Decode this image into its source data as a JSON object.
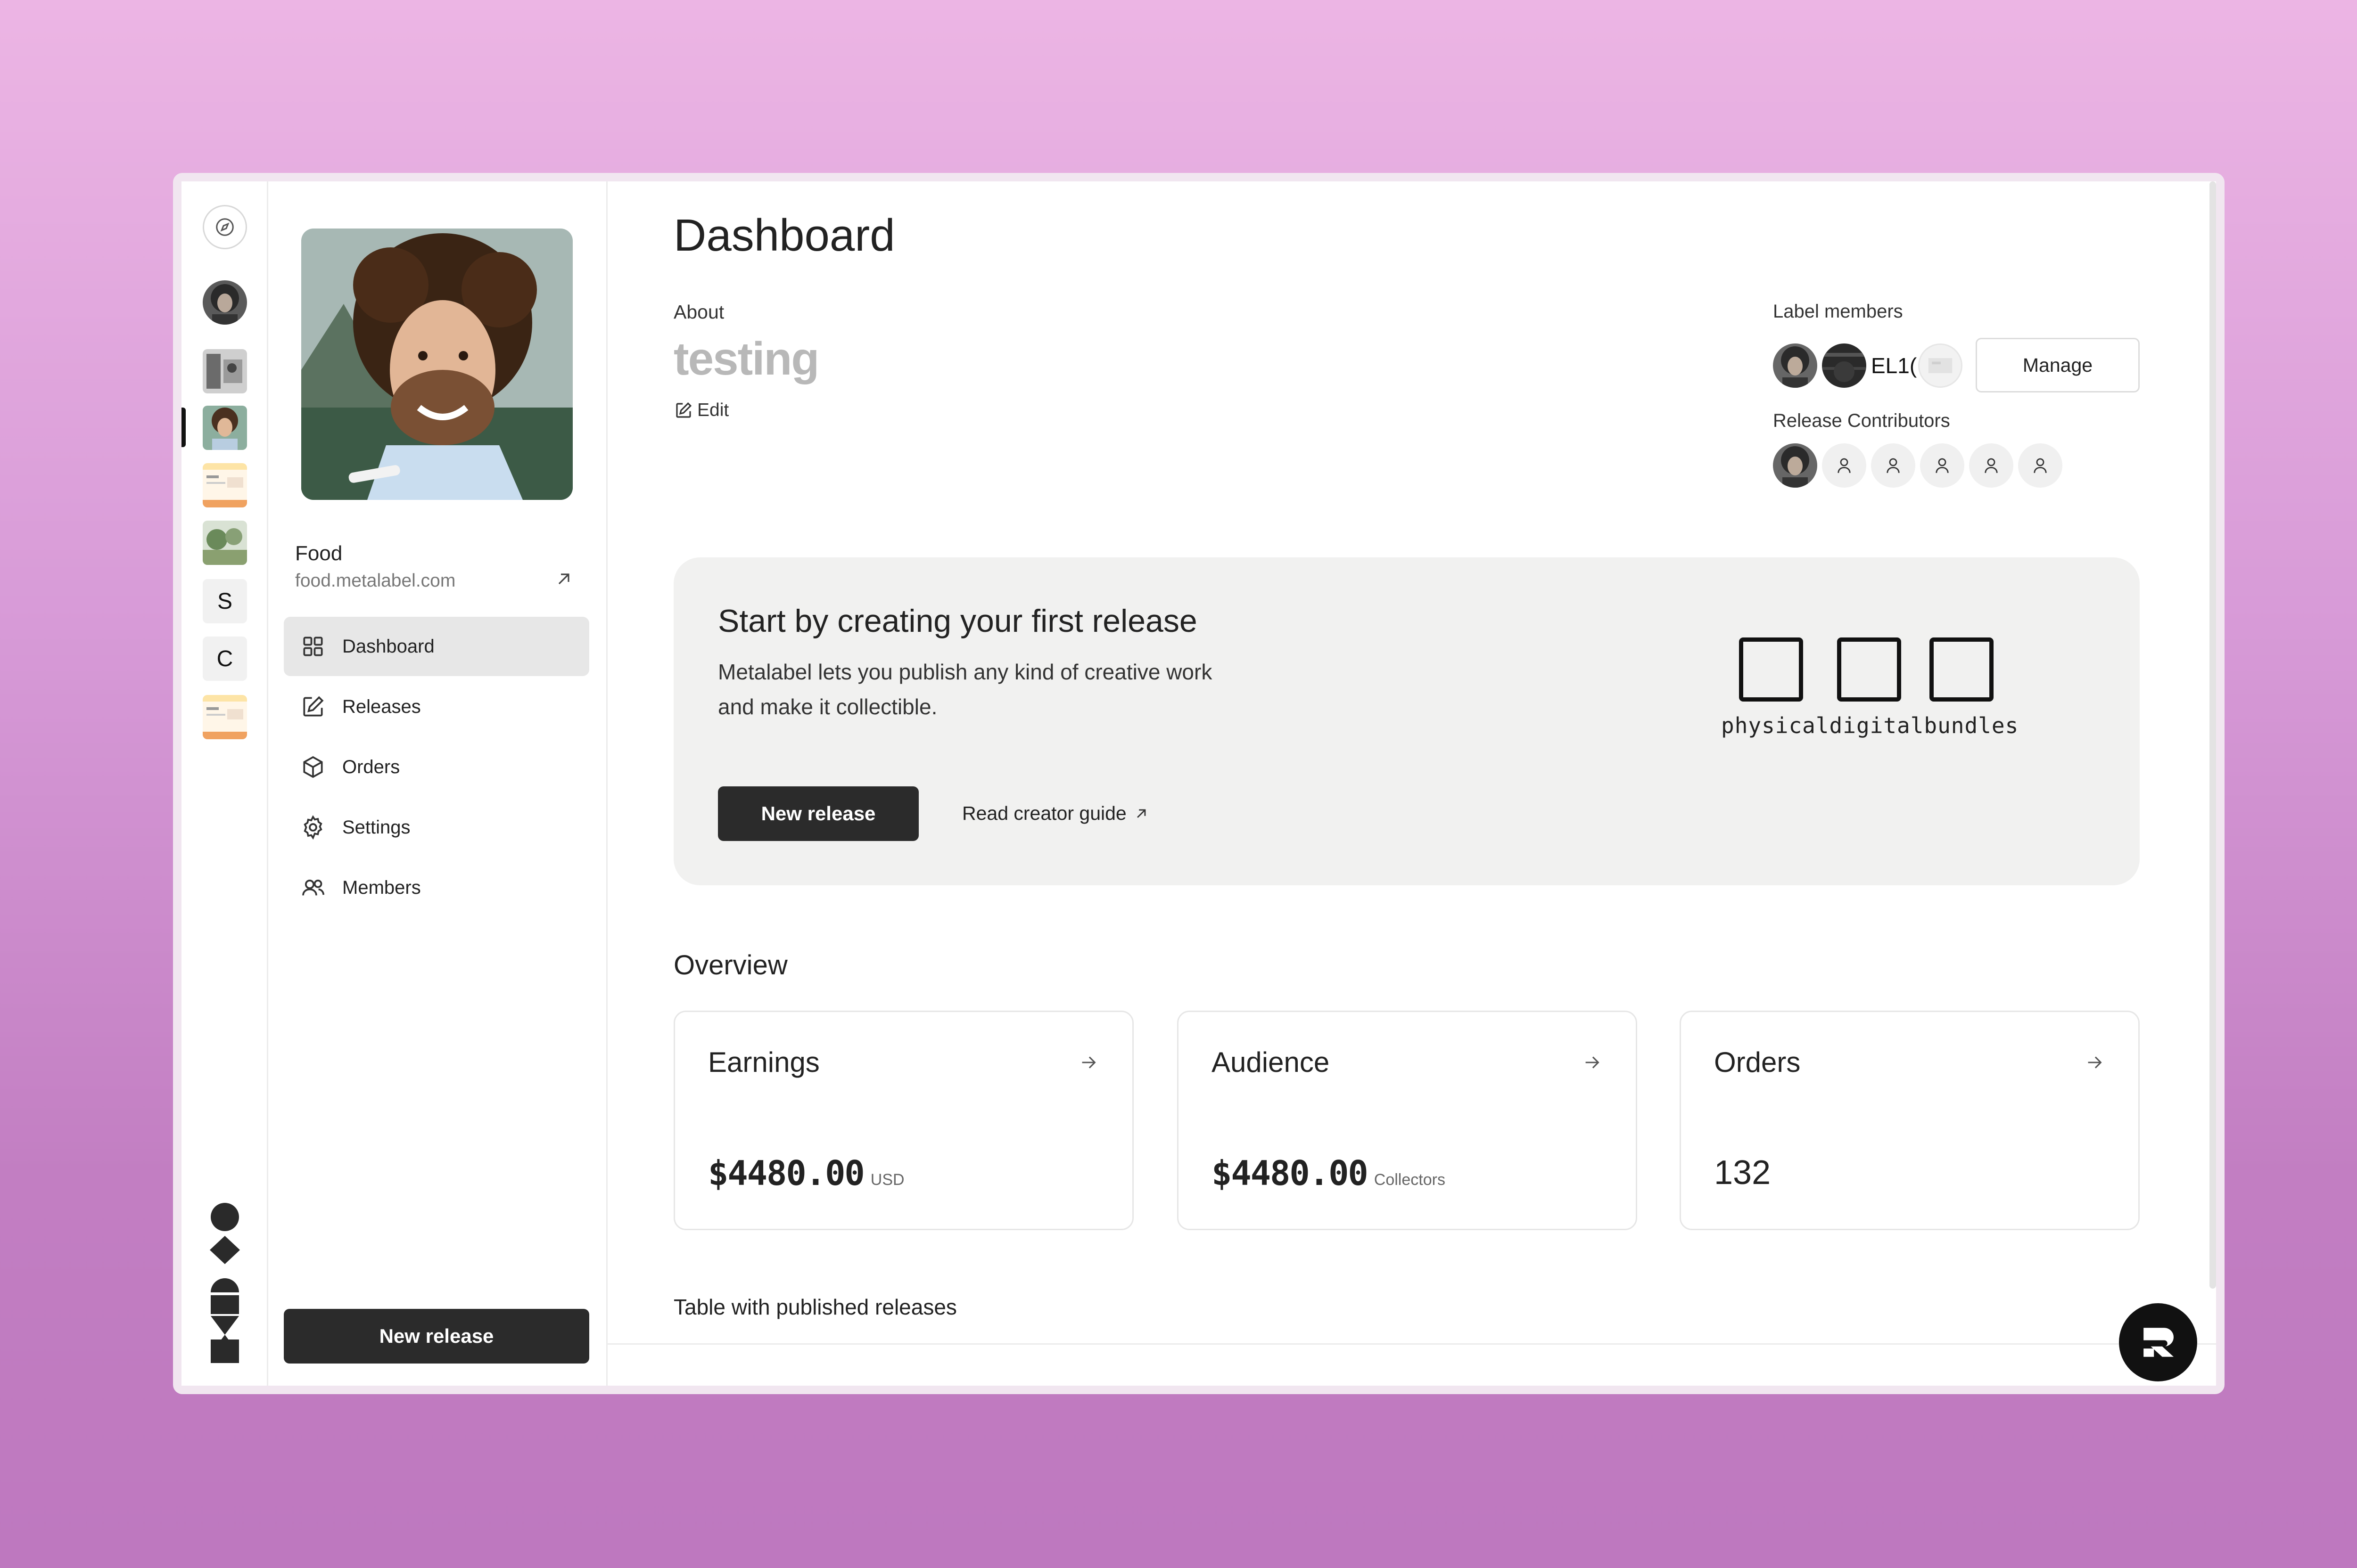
{
  "rail": {
    "letters": [
      "S",
      "C"
    ]
  },
  "sidebar": {
    "label_name": "Food",
    "label_url": "food.metalabel.com",
    "nav": [
      {
        "label": "Dashboard",
        "icon": "grid-icon",
        "active": true
      },
      {
        "label": "Releases",
        "icon": "edit-icon"
      },
      {
        "label": "Orders",
        "icon": "box-icon"
      },
      {
        "label": "Settings",
        "icon": "gear-icon"
      },
      {
        "label": "Members",
        "icon": "users-icon"
      }
    ],
    "new_release": "New release"
  },
  "header": {
    "title": "Dashboard",
    "about_label": "About",
    "about_value": "testing",
    "edit_label": "Edit"
  },
  "members": {
    "label": "Label members",
    "member_text": "EL1(",
    "manage": "Manage",
    "contributors_label": "Release Contributors"
  },
  "hero": {
    "title": "Start by creating your first release",
    "description": "Metalabel lets you publish any kind of creative work and make it collectible.",
    "button": "New release",
    "guide_link": "Read creator guide",
    "boxes_caption": "physicaldigitalbundles"
  },
  "overview": {
    "title": "Overview",
    "cards": [
      {
        "title": "Earnings",
        "value": "$4480.00",
        "unit": "USD"
      },
      {
        "title": "Audience",
        "value": "$4480.00",
        "unit": "Collectors"
      },
      {
        "title": "Orders",
        "value": "132",
        "unit": ""
      }
    ]
  },
  "table": {
    "title": "Table with published releases"
  },
  "colors": {
    "primary_button": "#2b2b2b",
    "hero_bg": "#f1f1f0",
    "active_nav": "#e7e7e7",
    "muted_text": "#b8b8b8"
  }
}
